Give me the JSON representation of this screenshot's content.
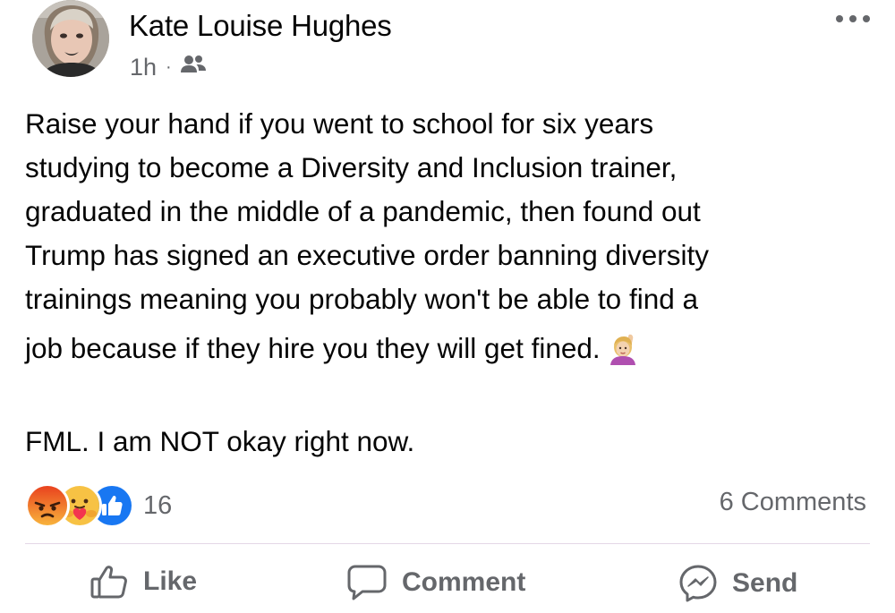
{
  "post": {
    "author": "Kate Louise Hughes",
    "time": "1h",
    "separator": "·",
    "audience_icon": "friends-icon",
    "more_icon": "more-options-icon",
    "text_lines": [
      "Raise your hand if you went to school for six years",
      "studying to become a Diversity and Inclusion trainer,",
      "graduated in the middle of a pandemic, then found out",
      "Trump has signed an executive order banning diversity",
      "trainings meaning you probably won't be able to find a",
      "job because if they hire you they will get fined."
    ],
    "text_emoji": "raising-hand-emoji",
    "second_paragraph": "FML. I am NOT okay right now."
  },
  "reactions": {
    "icons": [
      "angry-reaction-icon",
      "care-reaction-icon",
      "like-reaction-icon"
    ],
    "count": "16",
    "comments": "6 Comments"
  },
  "actions": {
    "like": "Like",
    "comment": "Comment",
    "send": "Send"
  },
  "colors": {
    "text": "#050505",
    "secondary": "#65676b",
    "like_blue": "#1877f2",
    "angry_orange": "#f7714c",
    "care_yellow": "#f7c244",
    "divider": "#e4d7e6"
  }
}
